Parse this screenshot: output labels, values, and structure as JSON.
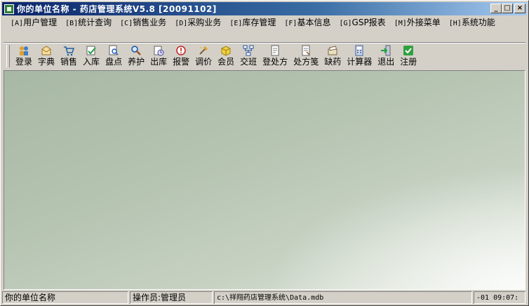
{
  "window": {
    "title": "你的单位名称 - 药店管理系统V5.8 [20091102]"
  },
  "title_buttons": {
    "minimize": "_",
    "maximize": "□",
    "close": "×"
  },
  "menu": [
    {
      "hotkey": "[A]",
      "label": "用户管理"
    },
    {
      "hotkey": "[B]",
      "label": "统计查询"
    },
    {
      "hotkey": "[C]",
      "label": "销售业务"
    },
    {
      "hotkey": "[D]",
      "label": "采购业务"
    },
    {
      "hotkey": "[E]",
      "label": "库存管理"
    },
    {
      "hotkey": "[F]",
      "label": "基本信息"
    },
    {
      "hotkey": "[G]",
      "label": "GSP报表"
    },
    {
      "hotkey": "[M]",
      "label": "外接菜单"
    },
    {
      "hotkey": "[H]",
      "label": "系统功能"
    }
  ],
  "toolbar": [
    {
      "label": "登录",
      "icon": "login-icon"
    },
    {
      "label": "字典",
      "icon": "dictionary-icon"
    },
    {
      "label": "销售",
      "icon": "cart-icon"
    },
    {
      "label": "入库",
      "icon": "stock-in-icon"
    },
    {
      "label": "盘点",
      "icon": "inventory-check-icon"
    },
    {
      "label": "养护",
      "icon": "magnifier-icon"
    },
    {
      "label": "出库",
      "icon": "stock-out-icon"
    },
    {
      "label": "报警",
      "icon": "alarm-icon"
    },
    {
      "label": "调价",
      "icon": "price-adjust-icon"
    },
    {
      "label": "会员",
      "icon": "member-icon"
    },
    {
      "label": "交班",
      "icon": "shift-handover-icon"
    },
    {
      "label": "登处方",
      "icon": "prescription-register-icon"
    },
    {
      "label": "处方笺",
      "icon": "prescription-note-icon"
    },
    {
      "label": "缺药",
      "icon": "shortage-icon"
    },
    {
      "label": "计算器",
      "icon": "calculator-icon"
    },
    {
      "label": "退出",
      "icon": "exit-icon"
    },
    {
      "label": "注册",
      "icon": "register-icon"
    }
  ],
  "status": {
    "company": "你的单位名称",
    "operator": "操作员:管理员",
    "database_path": "c:\\祥翔药店管理系统\\Data.mdb",
    "datetime": "-01 09:07:"
  },
  "colors": {
    "titlebar_start": "#0a246a",
    "titlebar_end": "#a6caf0",
    "client_background": "#b5c3b1"
  }
}
